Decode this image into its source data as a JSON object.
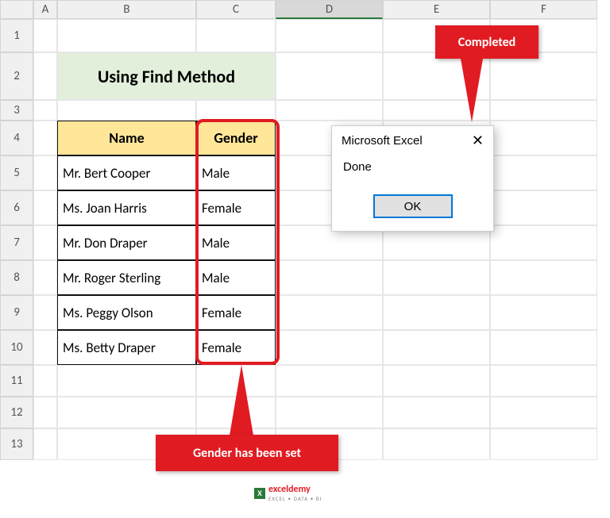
{
  "columns": [
    "",
    "A",
    "B",
    "C",
    "D",
    "E",
    "F"
  ],
  "rows": [
    "1",
    "2",
    "3",
    "4",
    "5",
    "6",
    "7",
    "8",
    "9",
    "10",
    "11",
    "12",
    "13"
  ],
  "selected_column_index": 4,
  "title": "Using Find Method",
  "table": {
    "headers": [
      "Name",
      "Gender"
    ],
    "rows": [
      {
        "name": "Mr. Bert Cooper",
        "gender": "Male"
      },
      {
        "name": "Ms. Joan Harris",
        "gender": "Female"
      },
      {
        "name": "Mr. Don Draper",
        "gender": "Male"
      },
      {
        "name": "Mr. Roger Sterling",
        "gender": "Male"
      },
      {
        "name": "Ms. Peggy Olson",
        "gender": "Female"
      },
      {
        "name": "Ms. Betty Draper",
        "gender": "Female"
      }
    ]
  },
  "dialog": {
    "title": "Microsoft Excel",
    "message": "Done",
    "ok": "OK"
  },
  "callouts": {
    "completed": "Completed",
    "gender_set": "Gender has been set"
  },
  "watermark": {
    "brand": "exceldemy",
    "tagline": "EXCEL • DATA • BI"
  },
  "colors": {
    "accent_red": "#e11b22",
    "header_fill": "#ffe699",
    "title_fill": "#e2efda"
  }
}
